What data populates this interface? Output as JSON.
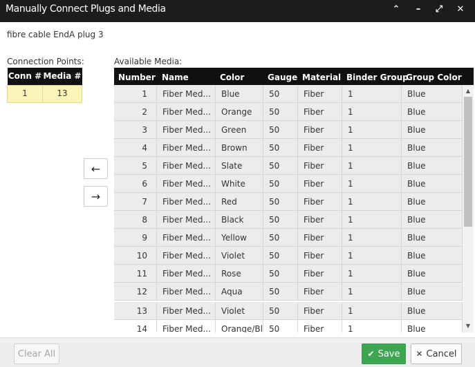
{
  "window": {
    "title": "Manually Connect Plugs and Media",
    "controls": {
      "collapse": "⌃",
      "minimize": "–",
      "maximize": "⤢",
      "close": "✕"
    }
  },
  "subtitle": "fibre cable EndA plug 3",
  "connection_points": {
    "label": "Connection Points:",
    "columns": [
      "Conn #",
      "Media #"
    ],
    "rows": [
      [
        "1",
        "13"
      ]
    ]
  },
  "arrows": {
    "left": "←",
    "right": "→"
  },
  "available_media": {
    "label": "Available Media:",
    "columns": [
      "Number",
      "Name",
      "Color",
      "Gauge",
      "Material",
      "Binder Group",
      "Group Color"
    ],
    "rows": [
      [
        "1",
        "Fiber Med...",
        "Blue",
        "50",
        "Fiber",
        "1",
        "Blue"
      ],
      [
        "2",
        "Fiber Med...",
        "Orange",
        "50",
        "Fiber",
        "1",
        "Blue"
      ],
      [
        "3",
        "Fiber Med...",
        "Green",
        "50",
        "Fiber",
        "1",
        "Blue"
      ],
      [
        "4",
        "Fiber Med...",
        "Brown",
        "50",
        "Fiber",
        "1",
        "Blue"
      ],
      [
        "5",
        "Fiber Med...",
        "Slate",
        "50",
        "Fiber",
        "1",
        "Blue"
      ],
      [
        "6",
        "Fiber Med...",
        "White",
        "50",
        "Fiber",
        "1",
        "Blue"
      ],
      [
        "7",
        "Fiber Med...",
        "Red",
        "50",
        "Fiber",
        "1",
        "Blue"
      ],
      [
        "8",
        "Fiber Med...",
        "Black",
        "50",
        "Fiber",
        "1",
        "Blue"
      ],
      [
        "9",
        "Fiber Med...",
        "Yellow",
        "50",
        "Fiber",
        "1",
        "Blue"
      ],
      [
        "10",
        "Fiber Med...",
        "Violet",
        "50",
        "Fiber",
        "1",
        "Blue"
      ],
      [
        "11",
        "Fiber Med...",
        "Rose",
        "50",
        "Fiber",
        "1",
        "Blue"
      ],
      [
        "12",
        "Fiber Med...",
        "Aqua",
        "50",
        "Fiber",
        "1",
        "Blue"
      ],
      [
        "13",
        "Fiber Med...",
        "Violet",
        "50",
        "Fiber",
        "1",
        "Blue"
      ],
      [
        "14",
        "Fiber Med...",
        "Orange/Bl.",
        "50",
        "Fiber",
        "1",
        "Blue"
      ]
    ]
  },
  "footer": {
    "clear_all": "Clear All",
    "save": "Save",
    "cancel": "Cancel"
  },
  "colors": {
    "titlebar": "#1c1c1c",
    "header": "#111111",
    "selected_row": "#fdf5b8",
    "save": "#3fa553"
  }
}
